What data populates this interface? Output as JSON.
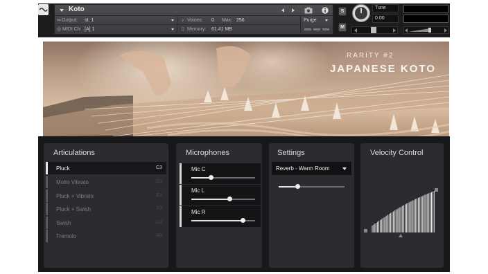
{
  "header": {
    "instrument_name": "Koto",
    "output_label": "Output:",
    "output_value": "st. 1",
    "voices_label": "Voices:",
    "voices_value": "0",
    "max_label": "Max:",
    "max_value": "256",
    "midi_label": "MIDI Ch:",
    "midi_value": "[A]  1",
    "memory_label": "Memory:",
    "memory_value": "61.41 MB",
    "purge_label": "Purge",
    "solo_label": "S",
    "mute_label": "M",
    "tune_label": "Tune",
    "tune_value": "0.00"
  },
  "banner": {
    "subtitle": "RARITY #2",
    "title": "JAPANESE KOTO"
  },
  "articulations": {
    "title": "Articulations",
    "items": [
      {
        "label": "Pluck",
        "key": "C3",
        "selected": true
      },
      {
        "label": "Molto Vibrato",
        "key": "D3",
        "selected": false
      },
      {
        "label": "Pluck + Vibrato",
        "key": "E3",
        "selected": false
      },
      {
        "label": "Pluck + Swish",
        "key": "F3",
        "selected": false
      },
      {
        "label": "Swish",
        "key": "G3",
        "selected": false
      },
      {
        "label": "Tremolo",
        "key": "A3",
        "selected": false
      }
    ]
  },
  "microphones": {
    "title": "Microphones",
    "items": [
      {
        "label": "Mic C",
        "level": 0.3
      },
      {
        "label": "Mic L",
        "level": 0.6
      },
      {
        "label": "Mic R",
        "level": 0.8
      }
    ]
  },
  "settings": {
    "title": "Settings",
    "reverb_preset": "Reverb - Warm Room",
    "reverb_amount": 0.28
  },
  "velocity": {
    "title": "Velocity Control"
  },
  "colors": {
    "panel_bg": "#2a2c2f",
    "body_bg": "#17181a",
    "header_bg": "#1b1c1e",
    "accent_white": "#e6e6e6"
  }
}
